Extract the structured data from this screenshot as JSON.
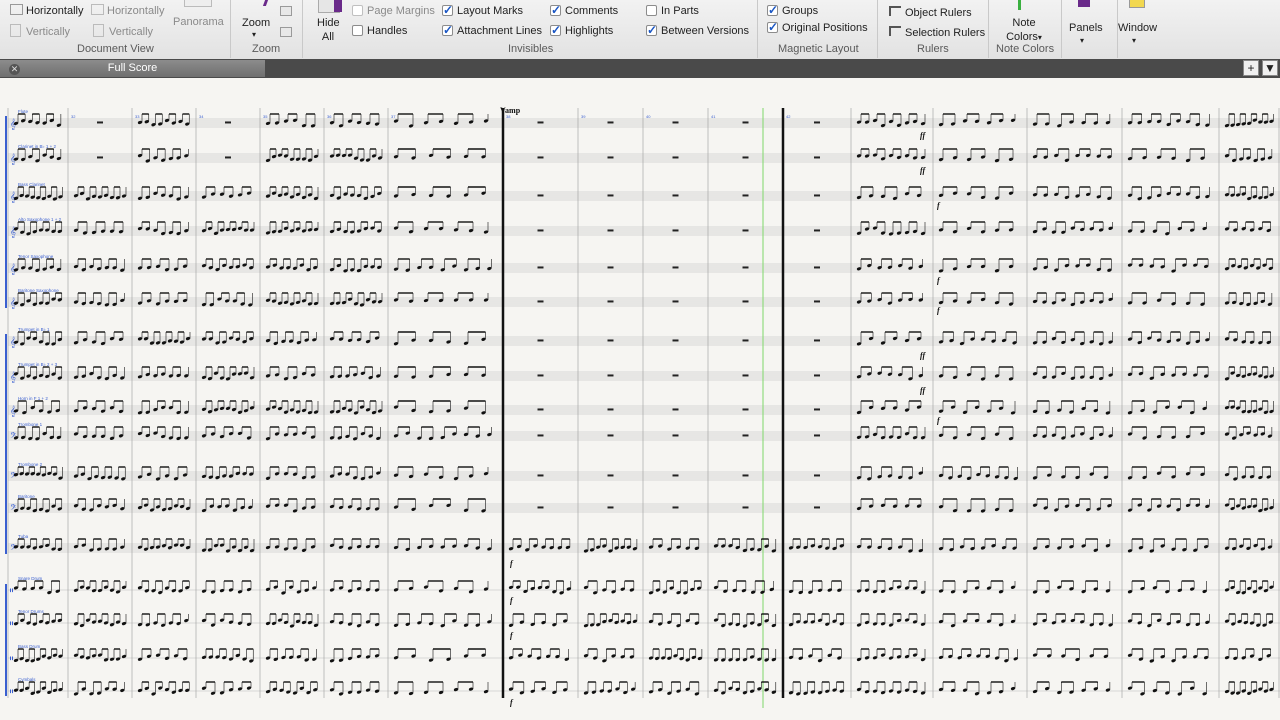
{
  "ribbon": {
    "document_view": {
      "group_label": "Document View",
      "horizontally_1": "Horizontally",
      "vertically_1": "Vertically",
      "horizontally_2": "Horizontally",
      "vertically_2": "Vertically",
      "panorama": "Panorama"
    },
    "zoom": {
      "button": "Zoom",
      "group_label": "Zoom"
    },
    "hide_all": {
      "line1": "Hide",
      "line2": "All"
    },
    "invisibles": {
      "group_label": "Invisibles",
      "page_margins": "Page Margins",
      "handles": "Handles",
      "layout_marks": "Layout Marks",
      "attachment_lines": "Attachment Lines",
      "comments": "Comments",
      "highlights": "Highlights",
      "in_parts": "In Parts",
      "between_versions": "Between Versions"
    },
    "magnetic_layout": {
      "group_label": "Magnetic Layout",
      "groups": "Groups",
      "original_positions": "Original Positions"
    },
    "rulers": {
      "group_label": "Rulers",
      "object_rulers": "Object Rulers",
      "selection_rulers": "Selection Rulers"
    },
    "note_colors": {
      "line1": "Note",
      "line2": "Colors",
      "group_label": "Note Colors"
    },
    "panels": "Panels",
    "window": "Window"
  },
  "tabs": {
    "active": "Full Score"
  },
  "score": {
    "rehearsal_mark": "Vamp",
    "instruments": [
      "Flute",
      "Clarinet in B♭ 1 + 2",
      "Bass Clarinet",
      "Alto Saxophone 1 + 2",
      "Tenor Saxophone",
      "Baritone Saxophone",
      "Trumpet in B♭ 1",
      "Trumpet in B♭ 2 + 3",
      "Horn in F 1 + 2",
      "Trombone 1",
      "Trombone 2",
      "Baritone",
      "Tuba",
      "Snare Drum",
      "Tenor Drums",
      "Bass Drum",
      "Cymbals"
    ],
    "bar_numbers": [
      "32",
      "33",
      "34",
      "35",
      "36",
      "37",
      "38",
      "39",
      "40",
      "41",
      "42"
    ]
  },
  "colors": {
    "instrument_label": "#3a5fd0",
    "playhead": "#7fd86a",
    "barline": "#222222",
    "staff_line": "#b9b9b9"
  }
}
